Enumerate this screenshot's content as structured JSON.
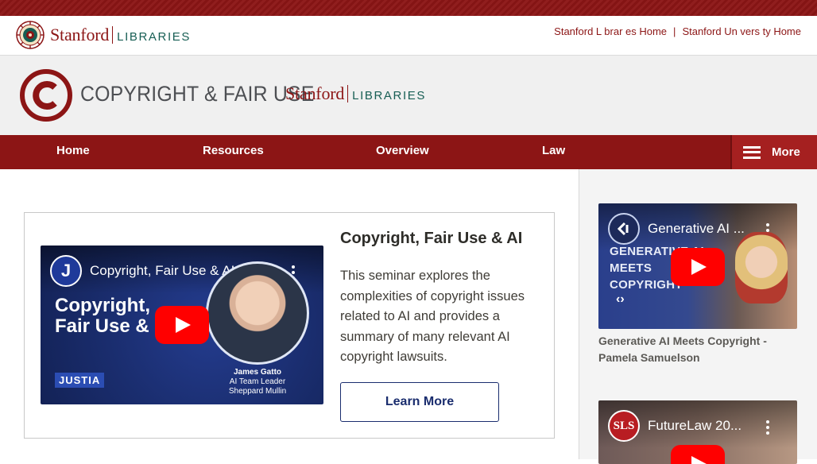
{
  "utility": {
    "logo_word": "Stanford",
    "logo_sub": "LIBRARIES",
    "links": [
      "Stanford L brar es Home",
      "Stanford Un vers ty Home"
    ],
    "separator": "|"
  },
  "banner": {
    "site_title": "COPYRIGHT & FAIR USE",
    "logo_word": "Stanford",
    "logo_sub": "LIBRARIES"
  },
  "nav": {
    "items": [
      "Home",
      "Resources",
      "Overview",
      "Law"
    ],
    "more_label": "More"
  },
  "feature": {
    "title": "Copyright, Fair Use & AI",
    "description": "This seminar explores the complexities of copyright issues related to AI and provides a summary of many relevant AI copyright lawsuits.",
    "button_label": "Learn More",
    "video": {
      "channel_initial": "J",
      "title": "Copyright, Fair Use & AI | Ju...",
      "overlay_line1": "Copyright,",
      "overlay_line2": "Fair Use &",
      "brand": "JUSTIA",
      "speaker_name": "James Gatto",
      "speaker_role": "AI Team Leader",
      "speaker_firm": "Sheppard Mullin"
    }
  },
  "sidebar": {
    "videos": [
      {
        "title": "Generative AI ...",
        "overlay_lines": [
          "GENERATIVE AI",
          "MEETS",
          "COPYRIGHT"
        ],
        "caption": "Generative AI Meets Copyright - Pamela Samuelson"
      },
      {
        "channel_initial": "SLS",
        "title": "FutureLaw 20..."
      }
    ]
  },
  "colors": {
    "cardinal": "#8c1515",
    "palo_alto_green": "#175e54",
    "navy": "#1a2d6e",
    "banner_bg": "#f0f0f0",
    "youtube_red": "#ff0000"
  },
  "icons": [
    "stanford-seal-icon",
    "copyright-icon",
    "menu-icon",
    "play-icon",
    "more-vert-icon"
  ]
}
